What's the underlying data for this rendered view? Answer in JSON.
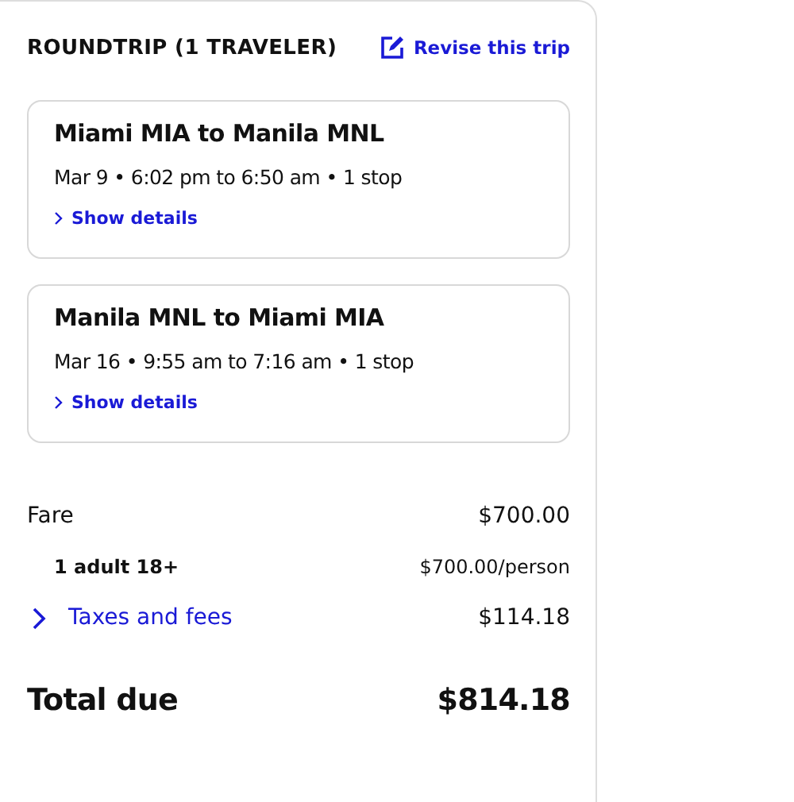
{
  "header": {
    "title": "ROUNDTRIP (1 TRAVELER)",
    "revise_link": "Revise this trip"
  },
  "flights": [
    {
      "route": "Miami MIA to Manila MNL",
      "schedule": "Mar 9 • 6:02 pm to 6:50 am • 1 stop",
      "details_link": "Show details"
    },
    {
      "route": "Manila MNL to Miami MIA",
      "schedule": "Mar 16 • 9:55 am to 7:16 am • 1 stop",
      "details_link": "Show details"
    }
  ],
  "price_lines": [
    {
      "kind": "main",
      "label": "Fare",
      "amount": "$700.00"
    },
    {
      "kind": "sub",
      "label": "1 adult 18+",
      "amount": "$700.00/person"
    },
    {
      "kind": "link",
      "label": "Taxes and fees",
      "amount": "$114.18"
    }
  ],
  "total": {
    "label": "Total due",
    "amount": "$814.18"
  }
}
